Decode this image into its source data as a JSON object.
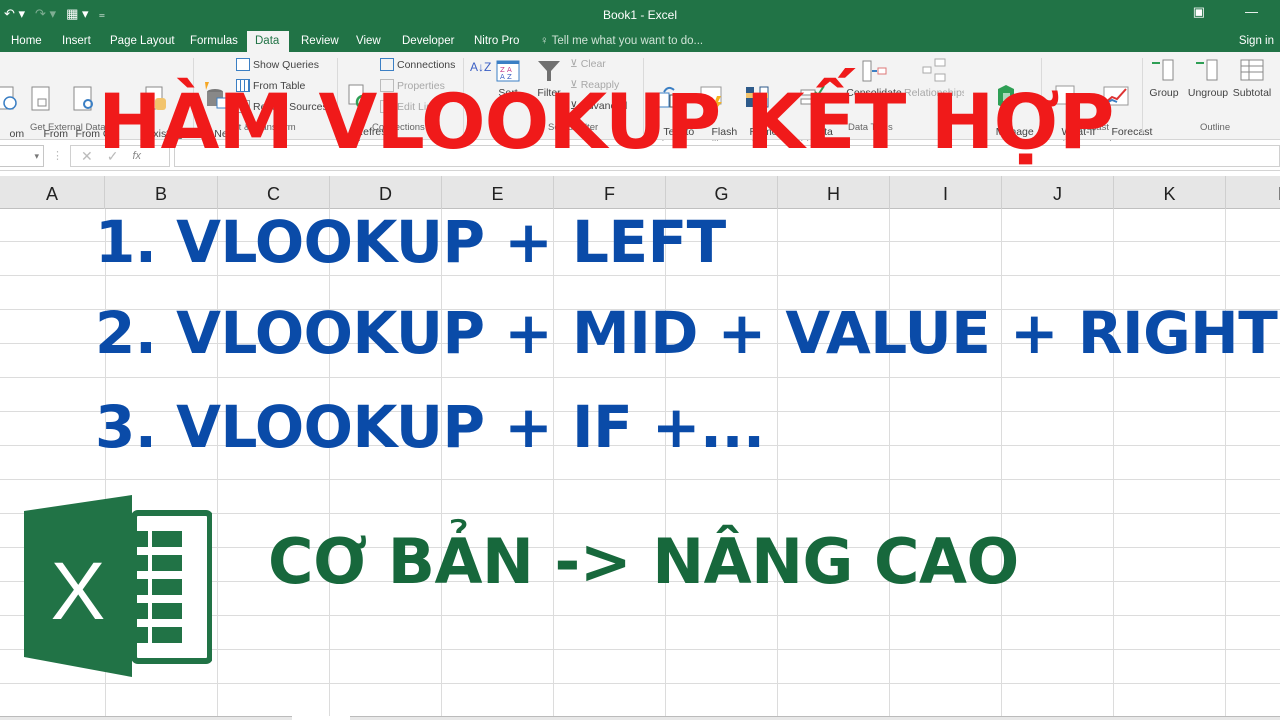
{
  "window": {
    "title": "Book1 - Excel",
    "quick_access": {
      "undo_icon": "undo-icon",
      "redo_icon": "redo-icon",
      "save_icon": "save-icon"
    },
    "controls": {
      "ribbon_display": "▣",
      "minimize": "—"
    }
  },
  "tabs": [
    {
      "label": "Home",
      "active": false
    },
    {
      "label": "Insert",
      "active": false
    },
    {
      "label": "Page Layout",
      "active": false
    },
    {
      "label": "Formulas",
      "active": false
    },
    {
      "label": "Data",
      "active": true
    },
    {
      "label": "Review",
      "active": false
    },
    {
      "label": "View",
      "active": false
    },
    {
      "label": "Developer",
      "active": false
    },
    {
      "label": "Nitro Pro",
      "active": false
    }
  ],
  "tell_me": "Tell me what you want to do...",
  "sign_in": "Sign in",
  "ribbon": {
    "buttons": {
      "from_web": "om\nWeb",
      "from_text": "From\nText",
      "from_other": "From Oth\nSources",
      "existing": "Existing\nConnections",
      "new_query": "New\nQuery ▾",
      "refresh": "Refresh\nAll ▾",
      "sort": "Sort",
      "filter": "Filter",
      "text_to_columns": "Text to\nColumns",
      "flash_fill": "Flash\nFill",
      "remove_duplicates": "Remove\nDuplicates",
      "data_validation": "Data\nValidation ▾",
      "consolidate": "Consolidate",
      "relationships": "Relationships",
      "manage_data_model": "Manage\nData Model",
      "what_if": "What-If\nAnalysis ▾",
      "forecast_sheet": "Forecast\nSheet",
      "group": "Group",
      "ungroup": "Ungroup",
      "subtotal": "Subtotal"
    },
    "small": {
      "show_queries": "Show Queries",
      "from_table": "From Table",
      "recent_sources": "Recent Sources",
      "connections": "Connections",
      "properties": "Properties",
      "edit_links": "Edit Links",
      "clear": "Clear",
      "reapply": "Reapply",
      "advanced": "Advanced"
    },
    "groups": {
      "get_external": "Get External Data",
      "get_transform": "Get & Transform",
      "connections": "Connections",
      "sort_filter": "Sort & Filter",
      "data_tools": "Data Tools",
      "forecast": "Forecast",
      "outline": "Outline"
    }
  },
  "formula_bar": {
    "name_box": "",
    "cancel": "✕",
    "enter": "✓",
    "fx": "fx",
    "value": ""
  },
  "columns": [
    "A",
    "B",
    "C",
    "D",
    "E",
    "F",
    "G",
    "H",
    "I",
    "J",
    "K",
    "L"
  ],
  "overlay": {
    "headline": "HÀM VLOOKUP KẾT HỢP",
    "items": [
      "1. VLOOKUP + LEFT",
      "2. VLOOKUP + MID + VALUE + RIGHT",
      "3. VLOOKUP + IF +..."
    ],
    "subtitle": "CƠ BẢN -> NÂNG CAO",
    "logo_letter": "X"
  },
  "colors": {
    "excel_green": "#217346",
    "headline_red": "#f01a1a",
    "item_blue": "#0a4ba8",
    "subtitle_green": "#17683c"
  }
}
